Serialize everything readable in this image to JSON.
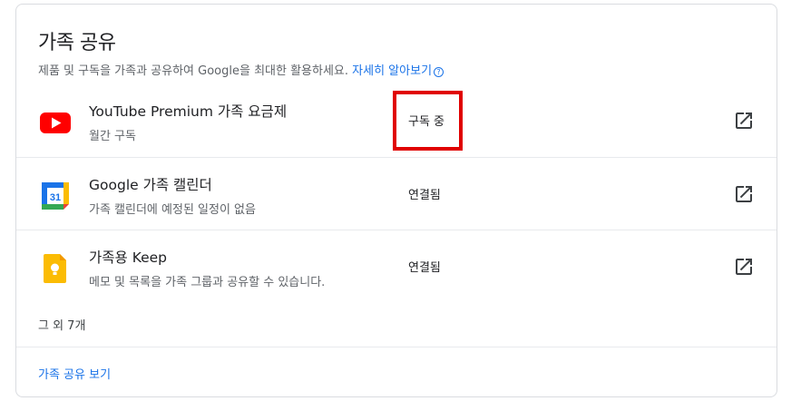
{
  "card": {
    "title": "가족 공유",
    "subtitle": "제품 및 구독을 가족과 공유하여 Google을 최대한 활용하세요.",
    "learn_more": "자세히 알아보기",
    "help_glyph": "?"
  },
  "services": [
    {
      "name": "YouTube Premium 가족 요금제",
      "description": "월간 구독",
      "status": "구독 중",
      "icon": "youtube-icon",
      "action_icon": "open-in-new-icon"
    },
    {
      "name": "Google 가족 캘린더",
      "description": "가족 캘린더에 예정된 일정이 없음",
      "status": "연결됨",
      "icon": "google-calendar-icon",
      "calendar_day": "31",
      "action_icon": "open-in-new-icon"
    },
    {
      "name": "가족용 Keep",
      "description": "메모 및 목록을 가족 그룹과 공유할 수 있습니다.",
      "status": "연결됨",
      "icon": "google-keep-icon",
      "action_icon": "open-in-new-icon"
    }
  ],
  "others_text": "그 외 7개",
  "footer_link": "가족 공유 보기",
  "colors": {
    "link": "#1a73e8",
    "highlight": "#e00000",
    "youtube_red": "#ff0000",
    "keep_yellow": "#fbbc04"
  }
}
